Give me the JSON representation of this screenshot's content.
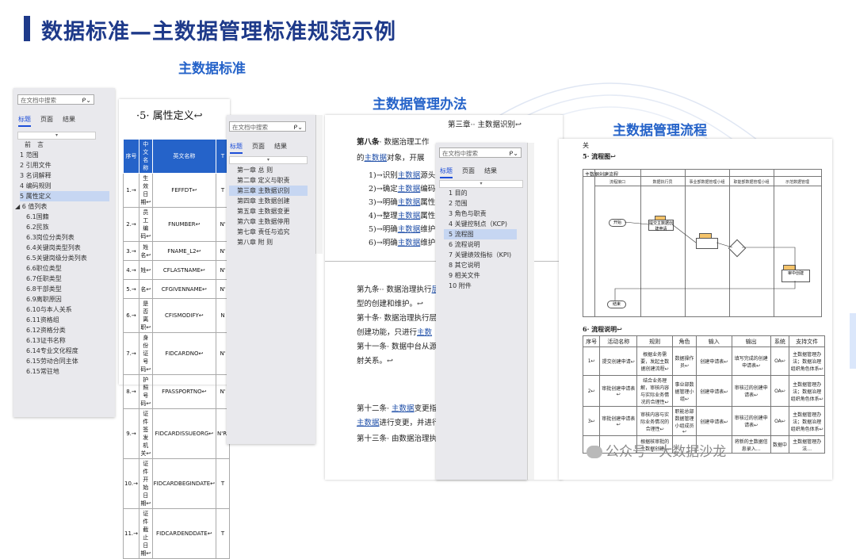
{
  "header": {
    "title": "数据标准—主数据管理标准规范示例"
  },
  "captions": {
    "standard": "主数据标准",
    "method": "主数据管理办法",
    "process": "主数据管理流程"
  },
  "nav1": {
    "search_placeholder": "在文档中搜索",
    "tabs": [
      "标题",
      "页面",
      "结果"
    ],
    "items": [
      "前　言",
      "1 范围",
      "2 引用文件",
      "3 名词解释",
      "4 编码规则",
      "5 属性定义",
      "◢ 6 值列表",
      "6.1国籍",
      "6.2民族",
      "6.3岗位分类列表",
      "6.4关键岗类型列表",
      "6.5关键岗级分类列表",
      "6.6职位类型",
      "6.7任职类型",
      "6.8干部类型",
      "6.9离职原因",
      "6.10与本人关系",
      "6.11资格组",
      "6.12资格分类",
      "6.13证书名称",
      "6.14专业文化程度",
      "6.15劳动合同主体",
      "6.15常驻地"
    ],
    "selected_index": 5
  },
  "attr_table": {
    "heading": "·5· 属性定义↩",
    "columns": [
      "序号",
      "中文名称",
      "英文名称",
      "T"
    ],
    "rows": [
      [
        "1.→",
        "生效日期↩",
        "FEFFDT↩",
        "T"
      ],
      [
        "2.→",
        "员工编码↩",
        "FNUMBER↩",
        "N'"
      ],
      [
        "3.→",
        "姓名↩",
        "FNAME_L2↩",
        "N'"
      ],
      [
        "4.→",
        "姓↩",
        "CFLASTNAME↩",
        "N'"
      ],
      [
        "5.→",
        "名↩",
        "CFGIVENNAME↩",
        "N'"
      ],
      [
        "6.→",
        "是否离职↩",
        "CFISMODIFY↩",
        "N"
      ],
      [
        "7.→",
        "身份证号码↩",
        "FIDCARDNO↩",
        "N'"
      ],
      [
        "8.→",
        "护照号码↩",
        "FPASSPORTNO↩",
        "N'"
      ],
      [
        "9.→",
        "证件签发机关↩",
        "FIDCARDISSUEORG↩",
        "N'R'"
      ],
      [
        "10.→",
        "证件开始日期↩",
        "FIDCARDBEGINDATE↩",
        "T"
      ],
      [
        "11.→",
        "证件截止日期↩",
        "FIDCARDENDDATE↩",
        "T"
      ]
    ]
  },
  "nav2": {
    "search_placeholder": "在文档中搜索",
    "tabs": [
      "标题",
      "页面",
      "结果"
    ],
    "items": [
      "第一章 总 则",
      "第二章 定义与职责",
      "第三章 主数据识别",
      "第四章 主数据创建",
      "第五章 主数据变更",
      "第六章 主数据停用",
      "第七章 责任与追究",
      "第八章 附 则"
    ],
    "selected_index": 2
  },
  "method_doc": {
    "chapter": "第三章·· 主数据识别↩",
    "art8_head": "第八条",
    "art8_text": "· 数据治理工作",
    "art8_line2a": "的",
    "art8_line2b": "主数据",
    "art8_line2c": "对象，开展",
    "list": [
      {
        "a": "1)→识别",
        "b": "主数据",
        "c": "源头"
      },
      {
        "a": "2)→确定",
        "b": "主数据",
        "c": "编码"
      },
      {
        "a": "3)→明确",
        "b": "主数据",
        "c": "属性"
      },
      {
        "a": "4)→整理",
        "b": "主数据",
        "c": "属性"
      },
      {
        "a": "5)→明确",
        "b": "主数据",
        "c": "维护"
      },
      {
        "a": "6)→明确",
        "b": "主数据",
        "c": "维护"
      }
    ],
    "art9": "第九条·· 数据治理执行",
    "art9_u": "层",
    "art9_line2": "型的创建和维护。↩",
    "art10": "第十条· 数据治理执行层",
    "art10_line2": "创建功能，只进行",
    "art10_line2_u": "主数",
    "art11": "第十一条· 数据中台从源",
    "art11_line2": "射关系。↩",
    "art12": "第十二条· ",
    "art12_u": "主数据",
    "art12_tail": "变更指",
    "art12_line2_u": "主数据",
    "art12_line2": "进行变更，并进行",
    "art13": "第十三条· 由数据治理执"
  },
  "nav3": {
    "search_placeholder": "在文档中搜索",
    "tabs": [
      "标题",
      "页面",
      "结果"
    ],
    "items": [
      "1 目的",
      "2 范围",
      "3 角色与职责",
      "4 关键控制点（KCP)",
      "5 流程图",
      "6 流程说明",
      "7 关键绩效指标（KPI)",
      "8 其它说明",
      "9 相关文件",
      "10 附件"
    ],
    "selected_index": 4
  },
  "process_doc": {
    "top_stub": "关",
    "flow_heading": "5· 流程图↩",
    "flow_title": "主数据创建流程",
    "lanes": [
      "流程接口",
      "数据执行员",
      "事业部数据管理小组",
      "职能部数据管理小组",
      "示范数据管理"
    ],
    "nodes": {
      "start": "开始",
      "create": "提交主数据创建申请",
      "end": "结束",
      "execute": "审中创建"
    },
    "desc_heading": "6· 流程说明↩",
    "columns": [
      "序号",
      "活动名称",
      "规则",
      "角色",
      "输入",
      "输出",
      "系统",
      "支持文件"
    ],
    "rows": [
      [
        "1↩",
        "提交创建申请↩",
        "根据业务需要，发起主数据创建流程↩",
        "数据操作员↩",
        "创建申请表↩",
        "填写完成的创建申请表↩",
        "OA↩",
        "主数据管理办法；数据治理组织角色体系↩"
      ],
      [
        "2↩",
        "审批创建申请表↩",
        "结合业务理解，审核内容与实际业务情况的合理性↩",
        "事业部数据管理小组↩",
        "创建申请表↩",
        "审核过的创建申请表↩",
        "OA↩",
        "主数据管理办法；数据治理组织角色体系↩"
      ],
      [
        "3↩",
        "审批创建申请表↩",
        "审核内容与实际业务情况的合理性↩",
        "职能总部数据管理小组成员↩",
        "创建申请表↩",
        "审核过的创建申请表↩",
        "OA↩",
        "主数据管理办法；数据治理组织角色体系↩"
      ],
      [
        "",
        "",
        "根据核审批的主数据创建…",
        "",
        "",
        "将新的主数据信息录入…",
        "数据中",
        "主数据管理办法…"
      ]
    ]
  },
  "watermark": "公众号 · 大数据沙龙",
  "colors": {
    "title": "#1e3a8a",
    "caption": "#2563c9",
    "table_header": "#2563c9",
    "nav_selected": "#c6d6f2"
  }
}
